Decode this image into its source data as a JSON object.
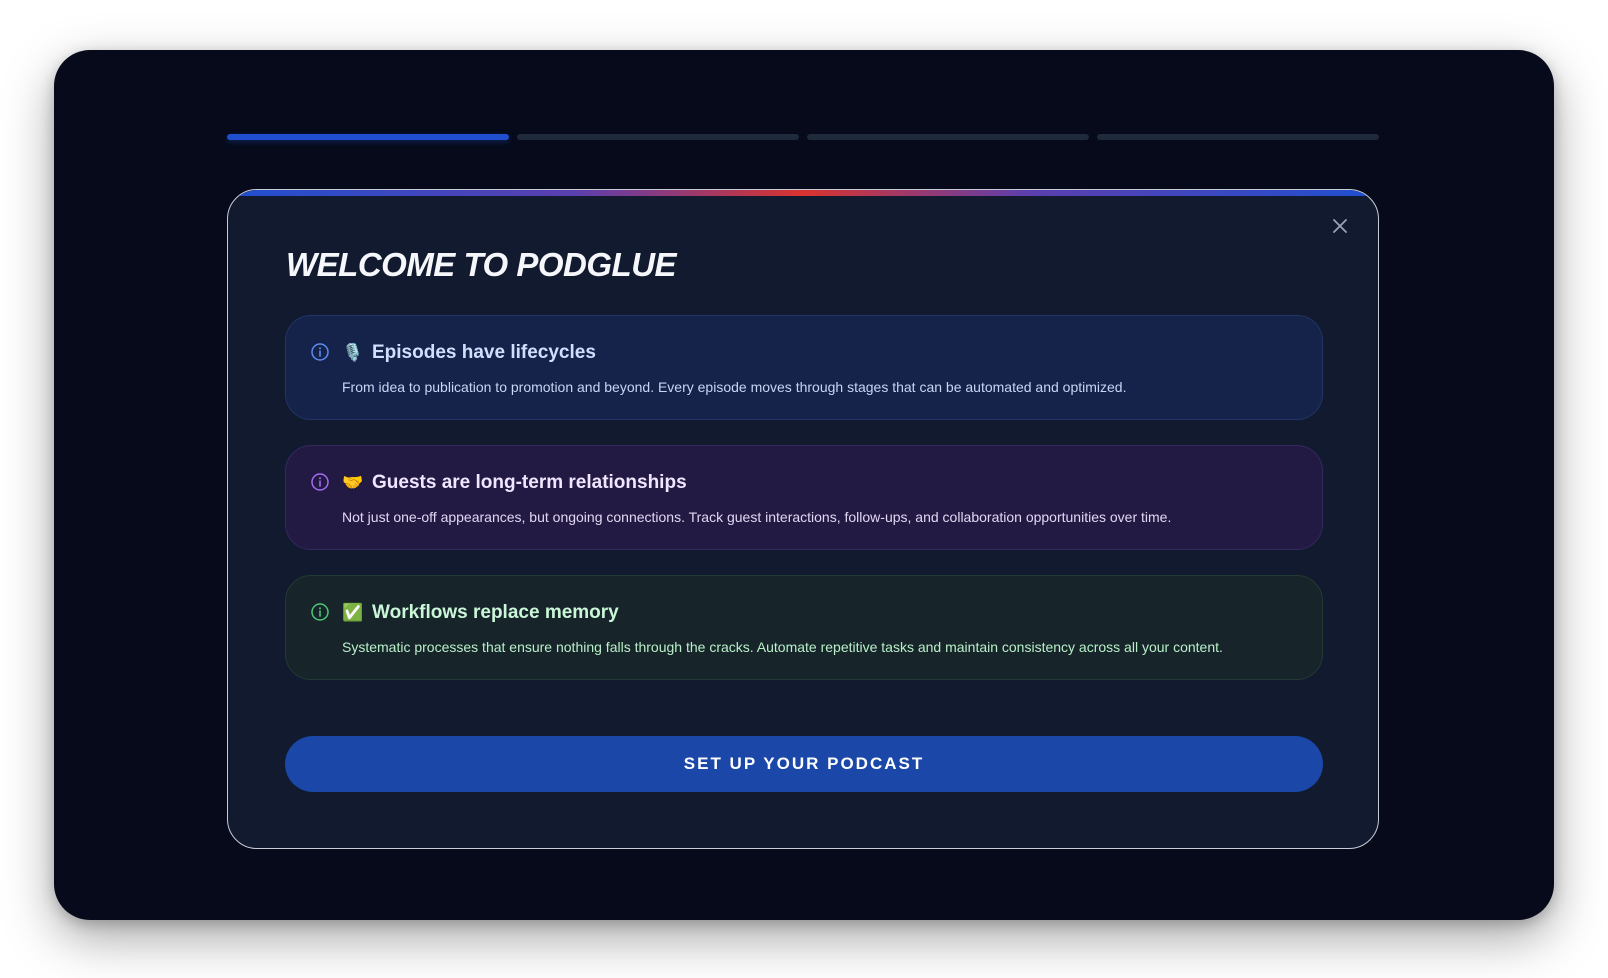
{
  "progress": {
    "total_steps": 4,
    "current_step": 1
  },
  "modal": {
    "title": "WELCOME TO PODGLUE",
    "close_icon": "close-icon"
  },
  "cards": [
    {
      "emoji": "🎙️",
      "heading": "Episodes have lifecycles",
      "description": "From idea to publication to promotion and beyond. Every episode moves through stages that can be automated and optimized.",
      "accent": "#5b8def",
      "icon": "info-icon"
    },
    {
      "emoji": "🤝",
      "heading": "Guests are long-term relationships",
      "description": "Not just one-off appearances, but ongoing connections. Track guest interactions, follow-ups, and collaboration opportunities over time.",
      "accent": "#a56cf0",
      "icon": "info-icon"
    },
    {
      "emoji": "✅",
      "heading": "Workflows replace memory",
      "description": "Systematic processes that ensure nothing falls through the cracks. Automate repetitive tasks and maintain consistency across all your content.",
      "accent": "#4cc777",
      "icon": "info-icon"
    }
  ],
  "cta": {
    "label": "SET UP YOUR PODCAST"
  },
  "colors": {
    "background": "#060a1a",
    "modal": "#111a2e",
    "primary": "#1a47a8",
    "progress_active": "#1f4fcf",
    "progress_inactive": "#1f2a3c"
  }
}
